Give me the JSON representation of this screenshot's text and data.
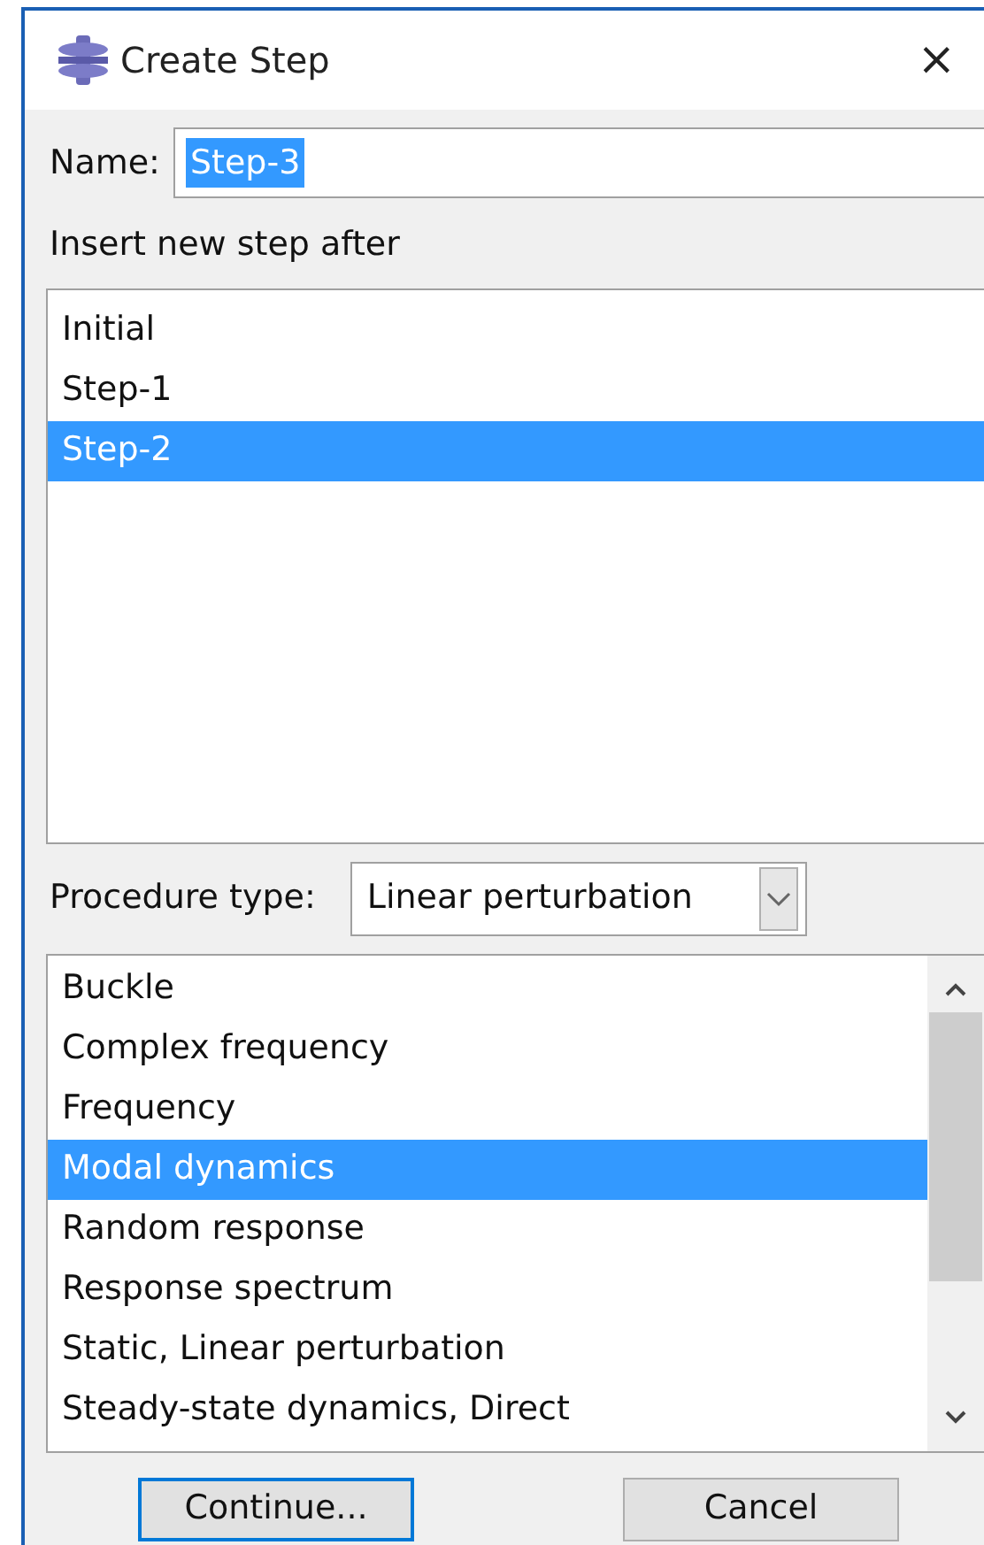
{
  "window": {
    "title": "Create Step",
    "close": "×"
  },
  "name_field": {
    "label": "Name:",
    "value": "Step-3",
    "text_selected": true
  },
  "insert_after": {
    "label": "Insert new step after",
    "items": [
      {
        "label": "Initial",
        "selected": false
      },
      {
        "label": "Step-1",
        "selected": false
      },
      {
        "label": "Step-2",
        "selected": true
      }
    ]
  },
  "procedure_type": {
    "label": "Procedure type:",
    "value": "Linear perturbation"
  },
  "procedures": [
    {
      "label": "Buckle",
      "selected": false
    },
    {
      "label": "Complex frequency",
      "selected": false
    },
    {
      "label": "Frequency",
      "selected": false
    },
    {
      "label": "Modal dynamics",
      "selected": true
    },
    {
      "label": "Random response",
      "selected": false
    },
    {
      "label": "Response spectrum",
      "selected": false
    },
    {
      "label": "Static, Linear perturbation",
      "selected": false
    },
    {
      "label": "Steady-state dynamics, Direct",
      "selected": false
    }
  ],
  "buttons": [
    {
      "label": "Continue...",
      "default": true
    },
    {
      "label": "Cancel",
      "default": false
    }
  ]
}
